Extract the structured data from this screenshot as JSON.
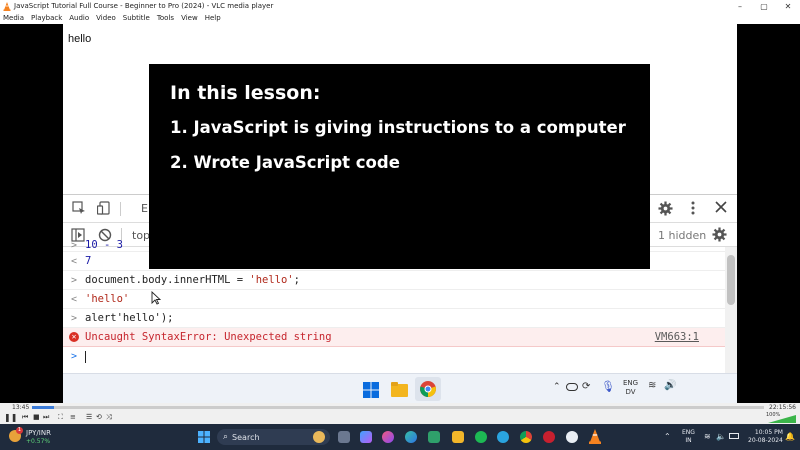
{
  "window": {
    "title": "JavaScript Tutorial Full Course - Beginner to Pro (2024) - VLC media player",
    "controls": [
      "–",
      "▢",
      "✕"
    ]
  },
  "menu": [
    "Media",
    "Playback",
    "Audio",
    "Video",
    "Subtitle",
    "Tools",
    "View",
    "Help"
  ],
  "page": {
    "output_text": "hello"
  },
  "devtools": {
    "tab_partial": "El",
    "context_partial": "top",
    "hidden_count": "1 hidden"
  },
  "console": {
    "line0": {
      "prompt": ">",
      "text": "10 - 3"
    },
    "line1": {
      "prompt": "<",
      "text": "7"
    },
    "line2": {
      "prompt": ">",
      "text_prefix": "document.body.innerHTML = ",
      "text_str": "'hello'",
      "text_suffix": ";"
    },
    "line3": {
      "prompt": "<",
      "text": "'hello'"
    },
    "line4": {
      "prompt": ">",
      "text": "alert'hello');"
    },
    "line5": {
      "text": "Uncaught SyntaxError: Unexpected string",
      "source": "VM663:1"
    },
    "line6": {
      "prompt": ">"
    }
  },
  "overlay": {
    "heading": "In this lesson:",
    "item1": "1. JavaScript is giving instructions to a computer",
    "item2": "2. Wrote JavaScript code"
  },
  "inner_taskbar": {
    "lang_top": "ENG",
    "lang_bottom": "DV"
  },
  "player": {
    "time_elapsed": "13:45",
    "time_total": "22:15:56",
    "progress_fraction": 0.03,
    "volume": "100%"
  },
  "host_taskbar": {
    "ticker": "JPY/INR",
    "ticker_change": "+0.57%",
    "search_label": "Search",
    "lang_top": "ENG",
    "lang_bottom": "IN",
    "time": "10:05 PM",
    "date": "20-08-2024",
    "notif_badge": "1"
  }
}
